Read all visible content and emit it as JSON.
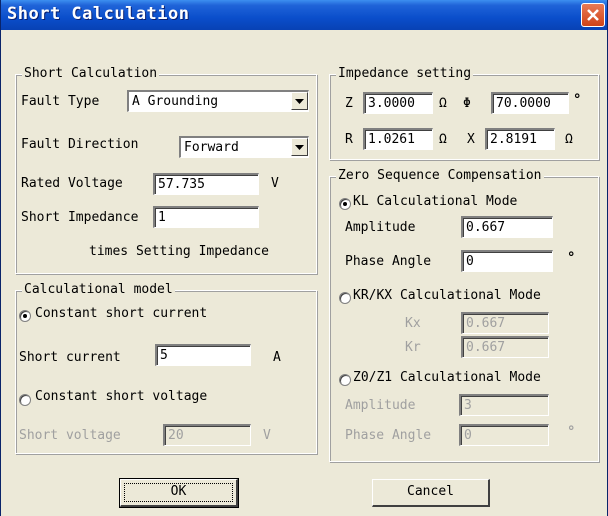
{
  "window": {
    "title": "Short Calculation"
  },
  "short_calc": {
    "legend": "Short Calculation",
    "fault_type_label": "Fault Type",
    "fault_type_value": "A Grounding",
    "fault_direction_label": "Fault Direction",
    "fault_direction_value": "Forward",
    "rated_voltage_label": "Rated Voltage",
    "rated_voltage_value": "57.735",
    "rated_voltage_unit": "V",
    "short_impedance_label": "Short Impedance",
    "short_impedance_value": "1",
    "times_setting_text": "times Setting Impedance"
  },
  "impedance": {
    "legend": "Impedance setting",
    "z_label": "Z",
    "z_value": "3.0000",
    "z_unit": "Ω",
    "phi_label": "Φ",
    "phi_value": "70.0000",
    "phi_unit": "°",
    "r_label": "R",
    "r_value": "1.0261",
    "r_unit": "Ω",
    "x_label": "X",
    "x_value": "2.8191",
    "x_unit": "Ω"
  },
  "calc_model": {
    "legend": "Calculational model",
    "constant_current_label": "Constant short current",
    "constant_current_selected": true,
    "short_current_label": "Short current",
    "short_current_value": "5",
    "short_current_unit": "A",
    "constant_voltage_label": "Constant short voltage",
    "constant_voltage_selected": false,
    "short_voltage_label": "Short voltage",
    "short_voltage_value": "20",
    "short_voltage_unit": "V"
  },
  "zero_seq": {
    "legend": "Zero Sequence Compensation",
    "kl_mode_label": "KL Calculational Mode",
    "kl_selected": true,
    "kl_amplitude_label": "Amplitude",
    "kl_amplitude_value": "0.667",
    "kl_phase_label": "Phase Angle",
    "kl_phase_value": "0",
    "kl_phase_unit": "°",
    "krkx_mode_label": "KR/KX Calculational Mode",
    "krkx_selected": false,
    "kx_label": "Kx",
    "kx_value": "0.667",
    "kr_label": "Kr",
    "kr_value": "0.667",
    "z0z1_mode_label": "Z0/Z1 Calculational Mode",
    "z0z1_selected": false,
    "z0z1_amplitude_label": "Amplitude",
    "z0z1_amplitude_value": "3",
    "z0z1_phase_label": "Phase Angle",
    "z0z1_phase_value": "0",
    "z0z1_phase_unit": "°"
  },
  "buttons": {
    "ok": "OK",
    "cancel": "Cancel"
  }
}
